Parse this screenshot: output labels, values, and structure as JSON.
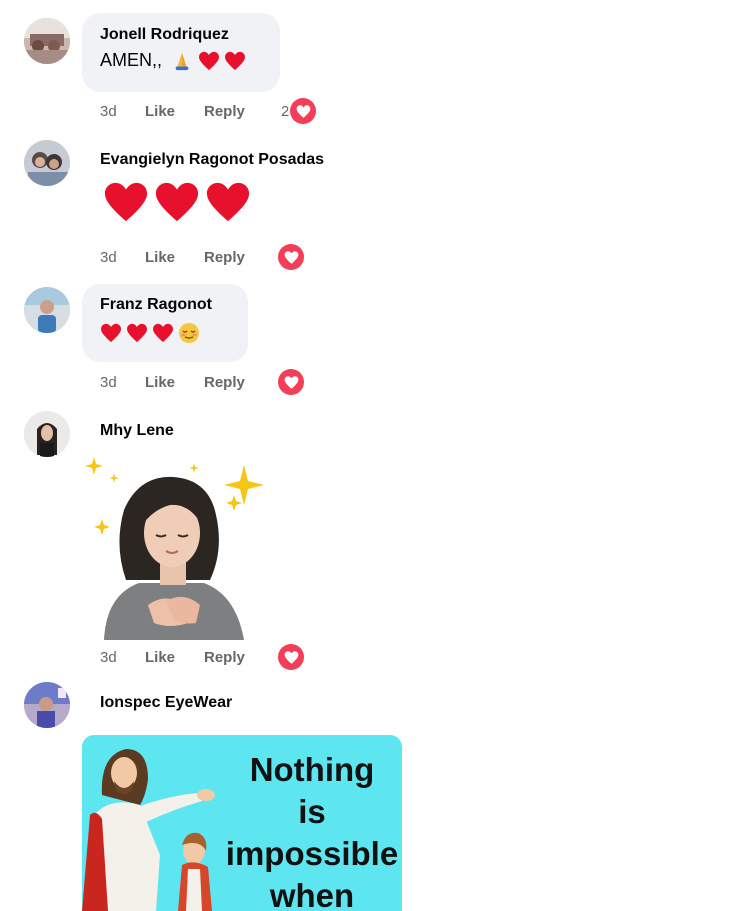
{
  "comments": [
    {
      "author": "Jonell Rodriquez",
      "text": "AMEN,,",
      "emojis": [
        "folded-hands",
        "red-heart",
        "red-heart"
      ],
      "time": "3d",
      "like": "Like",
      "reply": "Reply",
      "reaction_count": "2",
      "reaction": "love"
    },
    {
      "author": "Evangielyn Ragonot Posadas",
      "emojis": [
        "red-heart",
        "red-heart",
        "red-heart"
      ],
      "time": "3d",
      "like": "Like",
      "reply": "Reply",
      "reaction": "love"
    },
    {
      "author": "Franz Ragonot",
      "emojis": [
        "red-heart",
        "red-heart",
        "red-heart",
        "relieved-face"
      ],
      "time": "3d",
      "like": "Like",
      "reply": "Reply",
      "reaction": "love"
    },
    {
      "author": "Mhy Lene",
      "attachment": "sticker-avatar-hands-on-heart",
      "time": "3d",
      "like": "Like",
      "reply": "Reply",
      "reaction": "love"
    },
    {
      "author": "Ionspec EyeWear",
      "attachment": "image-jesus-with-child",
      "image_text": [
        "Nothing",
        "is",
        "impossible",
        "when"
      ]
    }
  ],
  "colors": {
    "bubble": "#f0f2f5",
    "meta": "#65676b",
    "love": "#f33e58",
    "poster_bg": "#5ee6f0"
  }
}
